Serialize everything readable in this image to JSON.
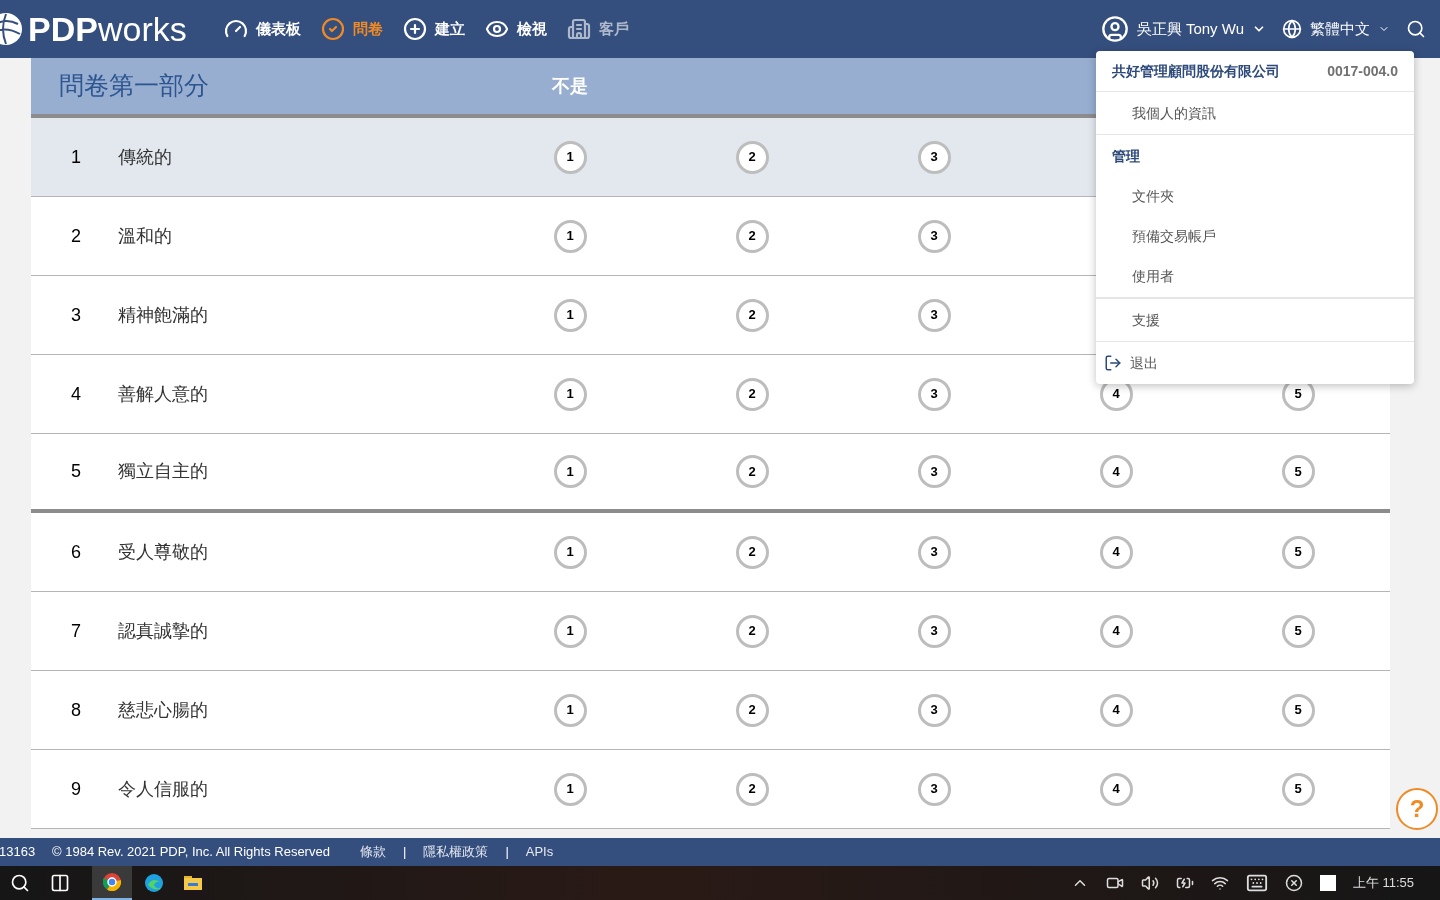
{
  "nav": {
    "logo": {
      "strong": "PDP",
      "light": "works"
    },
    "items": [
      {
        "label": "儀表板",
        "selected": false,
        "disabled": false
      },
      {
        "label": "問卷",
        "selected": true,
        "disabled": false
      },
      {
        "label": "建立",
        "selected": false,
        "disabled": false
      },
      {
        "label": "檢視",
        "selected": false,
        "disabled": false
      },
      {
        "label": "客戶",
        "selected": false,
        "disabled": true
      }
    ],
    "user": "吳正興 Tony Wu",
    "language": "繁體中文"
  },
  "questionnaire": {
    "title": "問卷第一部分",
    "column_1": "不是",
    "rows": [
      {
        "number": "1",
        "label": "傳統的",
        "selected": true,
        "options": [
          "1",
          "2",
          "3"
        ]
      },
      {
        "number": "2",
        "label": "溫和的",
        "selected": false,
        "options": [
          "1",
          "2",
          "3"
        ]
      },
      {
        "number": "3",
        "label": "精神飽滿的",
        "selected": false,
        "options": [
          "1",
          "2",
          "3"
        ]
      },
      {
        "number": "4",
        "label": "善解人意的",
        "selected": false,
        "options": [
          "1",
          "2",
          "3",
          "4",
          "5"
        ]
      },
      {
        "number": "5",
        "label": "獨立自主的",
        "selected": false,
        "options": [
          "1",
          "2",
          "3",
          "4",
          "5"
        ]
      },
      {
        "number": "6",
        "label": "受人尊敬的",
        "selected": false,
        "options": [
          "1",
          "2",
          "3",
          "4",
          "5"
        ]
      },
      {
        "number": "7",
        "label": "認真誠摯的",
        "selected": false,
        "options": [
          "1",
          "2",
          "3",
          "4",
          "5"
        ]
      },
      {
        "number": "8",
        "label": "慈悲心腸的",
        "selected": false,
        "options": [
          "1",
          "2",
          "3",
          "4",
          "5"
        ]
      },
      {
        "number": "9",
        "label": "令人信服的",
        "selected": false,
        "options": [
          "1",
          "2",
          "3",
          "4",
          "5"
        ]
      }
    ]
  },
  "user_menu": {
    "company": "共好管理顧問股份有限公司",
    "code": "0017-004.0",
    "groups": [
      {
        "items": [
          {
            "label": "我個人的資訊",
            "kind": "item"
          }
        ]
      },
      {
        "items": [
          {
            "label": "管理",
            "kind": "heading"
          },
          {
            "label": "文件夾",
            "kind": "item"
          },
          {
            "label": "預備交易帳戶",
            "kind": "item"
          },
          {
            "label": "使用者",
            "kind": "item"
          }
        ]
      },
      {
        "items": [
          {
            "label": "支援",
            "kind": "item"
          }
        ]
      },
      {
        "items": [
          {
            "label": "退出",
            "kind": "logout"
          }
        ]
      }
    ]
  },
  "help": "?",
  "footer": {
    "build": "13163",
    "copyright": "© 1984 Rev. 2021 PDP, Inc. All Rights Reserved",
    "links": [
      "條款",
      "隱私權政策",
      "APIs"
    ],
    "separators": [
      "|",
      "|"
    ]
  },
  "taskbar": {
    "time": "上午 11:55"
  }
}
